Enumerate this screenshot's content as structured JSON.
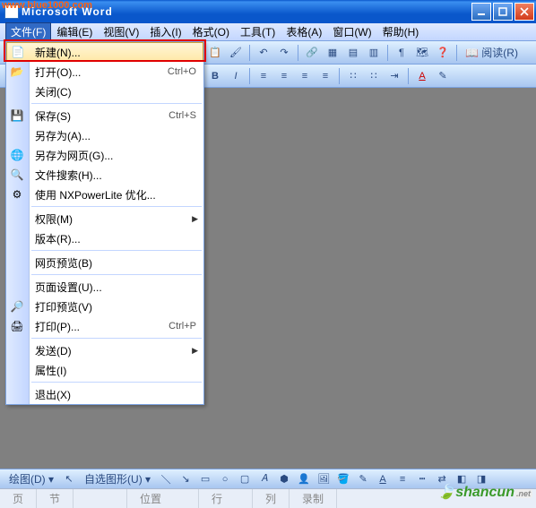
{
  "watermark_url": "www.blue1000.com",
  "title": "Microsoft Word",
  "menubar": [
    {
      "label": "文件(F)",
      "open": true,
      "name": "menu-file"
    },
    {
      "label": "编辑(E)",
      "name": "menu-edit"
    },
    {
      "label": "视图(V)",
      "name": "menu-view"
    },
    {
      "label": "插入(I)",
      "name": "menu-insert"
    },
    {
      "label": "格式(O)",
      "name": "menu-format"
    },
    {
      "label": "工具(T)",
      "name": "menu-tools"
    },
    {
      "label": "表格(A)",
      "name": "menu-table"
    },
    {
      "label": "窗口(W)",
      "name": "menu-window"
    },
    {
      "label": "帮助(H)",
      "name": "menu-help"
    }
  ],
  "toolbar_read": "阅读(R)",
  "dropdown": [
    {
      "icon": "📄",
      "label": "新建(N)...",
      "accel": "",
      "highlight": true,
      "name": "new"
    },
    {
      "icon": "📂",
      "label": "打开(O)...",
      "accel": "Ctrl+O",
      "name": "open"
    },
    {
      "icon": "",
      "label": "关闭(C)",
      "accel": "",
      "name": "close"
    },
    {
      "sep": true
    },
    {
      "icon": "💾",
      "label": "保存(S)",
      "accel": "Ctrl+S",
      "name": "save"
    },
    {
      "icon": "",
      "label": "另存为(A)...",
      "accel": "",
      "name": "save-as"
    },
    {
      "icon": "🌐",
      "label": "另存为网页(G)...",
      "accel": "",
      "name": "save-as-web"
    },
    {
      "icon": "🔍",
      "label": "文件搜索(H)...",
      "accel": "",
      "name": "file-search"
    },
    {
      "icon": "⚙",
      "label": "使用 NXPowerLite 优化...",
      "accel": "",
      "name": "nxpowerlite"
    },
    {
      "sep": true
    },
    {
      "icon": "",
      "label": "权限(M)",
      "accel": "",
      "submenu": true,
      "name": "permissions"
    },
    {
      "icon": "",
      "label": "版本(R)...",
      "accel": "",
      "name": "versions"
    },
    {
      "sep": true
    },
    {
      "icon": "",
      "label": "网页预览(B)",
      "accel": "",
      "name": "web-preview"
    },
    {
      "sep": true
    },
    {
      "icon": "",
      "label": "页面设置(U)...",
      "accel": "",
      "name": "page-setup"
    },
    {
      "icon": "🔎",
      "label": "打印预览(V)",
      "accel": "",
      "name": "print-preview"
    },
    {
      "icon": "🖨",
      "label": "打印(P)...",
      "accel": "Ctrl+P",
      "name": "print"
    },
    {
      "sep": true
    },
    {
      "icon": "",
      "label": "发送(D)",
      "accel": "",
      "submenu": true,
      "name": "send"
    },
    {
      "icon": "",
      "label": "属性(I)",
      "accel": "",
      "name": "properties"
    },
    {
      "sep": true
    },
    {
      "icon": "",
      "label": "退出(X)",
      "accel": "",
      "name": "exit"
    }
  ],
  "drawbar": {
    "draw": "绘图(D)",
    "autoshape": "自选图形(U)"
  },
  "statusbar": {
    "page": "页",
    "section": "节",
    "position": "位置",
    "line": "行",
    "column": "列",
    "rec": "录制"
  },
  "shancun": "shancun",
  "shancun_ext": ".net"
}
